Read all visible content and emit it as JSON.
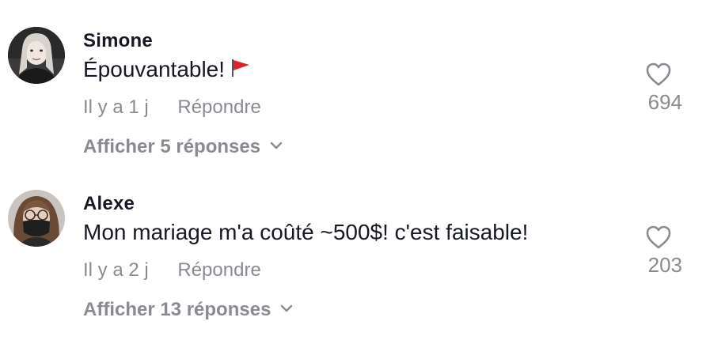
{
  "comments": [
    {
      "username": "Simone",
      "text": "Épouvantable!",
      "emoji": "triangular-flag",
      "time": "Il y a 1 j",
      "reply_label": "Répondre",
      "replies_label": "Afficher 5 réponses",
      "likes": "694"
    },
    {
      "username": "Alexe",
      "text": "Mon mariage m'a coûté ~500$! c'est faisable!",
      "time": "Il y a 2 j",
      "reply_label": "Répondre",
      "replies_label": "Afficher 13 réponses",
      "likes": "203"
    }
  ],
  "colors": {
    "primary_text": "#161823",
    "secondary_text": "#8a8b91",
    "flag_red": "#e0202a"
  },
  "icons": [
    "heart-icon",
    "chevron-down-icon",
    "flag-icon",
    "avatar"
  ]
}
